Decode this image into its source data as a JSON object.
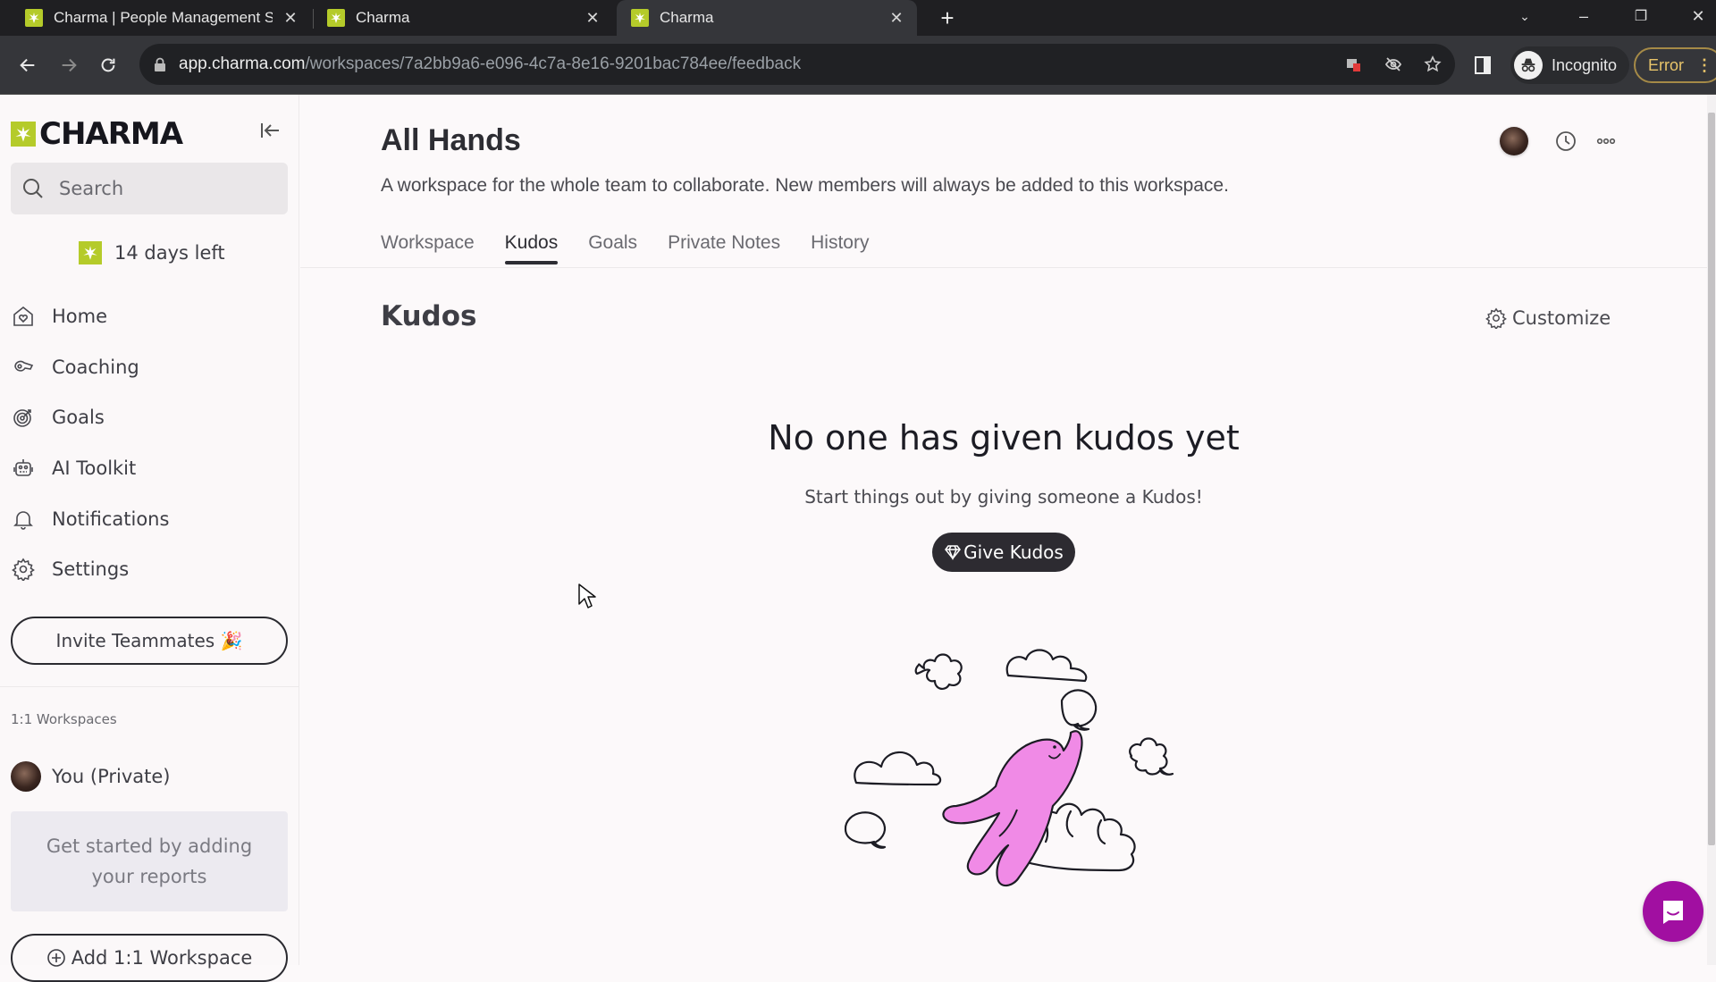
{
  "browser": {
    "tabs": [
      {
        "title": "Charma | People Management S",
        "active": false
      },
      {
        "title": "Charma",
        "active": false
      },
      {
        "title": "Charma",
        "active": true
      }
    ],
    "url_host": "app.charma.com",
    "url_path": "/workspaces/7a2bb9a6-e096-4c7a-8e16-9201bac784ee/feedback",
    "incognito_label": "Incognito",
    "error_label": "Error"
  },
  "sidebar": {
    "brand": "CHARMA",
    "search_placeholder": "Search",
    "trial_label": "14 days left",
    "nav": [
      {
        "label": "Home",
        "icon": "home-heart-icon"
      },
      {
        "label": "Coaching",
        "icon": "whistle-icon"
      },
      {
        "label": "Goals",
        "icon": "target-icon"
      },
      {
        "label": "AI Toolkit",
        "icon": "robot-icon"
      },
      {
        "label": "Notifications",
        "icon": "bell-icon"
      },
      {
        "label": "Settings",
        "icon": "gear-icon"
      }
    ],
    "invite_label": "Invite Teammates 🎉",
    "workspaces_heading": "1:1 Workspaces",
    "private_workspace": "You (Private)",
    "hint": "Get started by adding your reports",
    "add_workspace_label": "Add 1:1 Workspace"
  },
  "main": {
    "title": "All Hands",
    "description": "A workspace for the whole team to collaborate. New members will always be added to this workspace.",
    "tabs": [
      {
        "label": "Workspace",
        "active": false
      },
      {
        "label": "Kudos",
        "active": true
      },
      {
        "label": "Goals",
        "active": false
      },
      {
        "label": "Private Notes",
        "active": false
      },
      {
        "label": "History",
        "active": false
      }
    ],
    "section_title": "Kudos",
    "customize_label": "Customize",
    "empty_title": "No one has given kudos yet",
    "empty_subtitle": "Start things out by giving someone a Kudos!",
    "give_kudos_label": "Give Kudos"
  },
  "colors": {
    "brand_green": "#b5cb2a",
    "chat_magenta": "#a10fa1",
    "illustration_pink": "#f08ae6",
    "primary_dark": "#2d2b31"
  }
}
